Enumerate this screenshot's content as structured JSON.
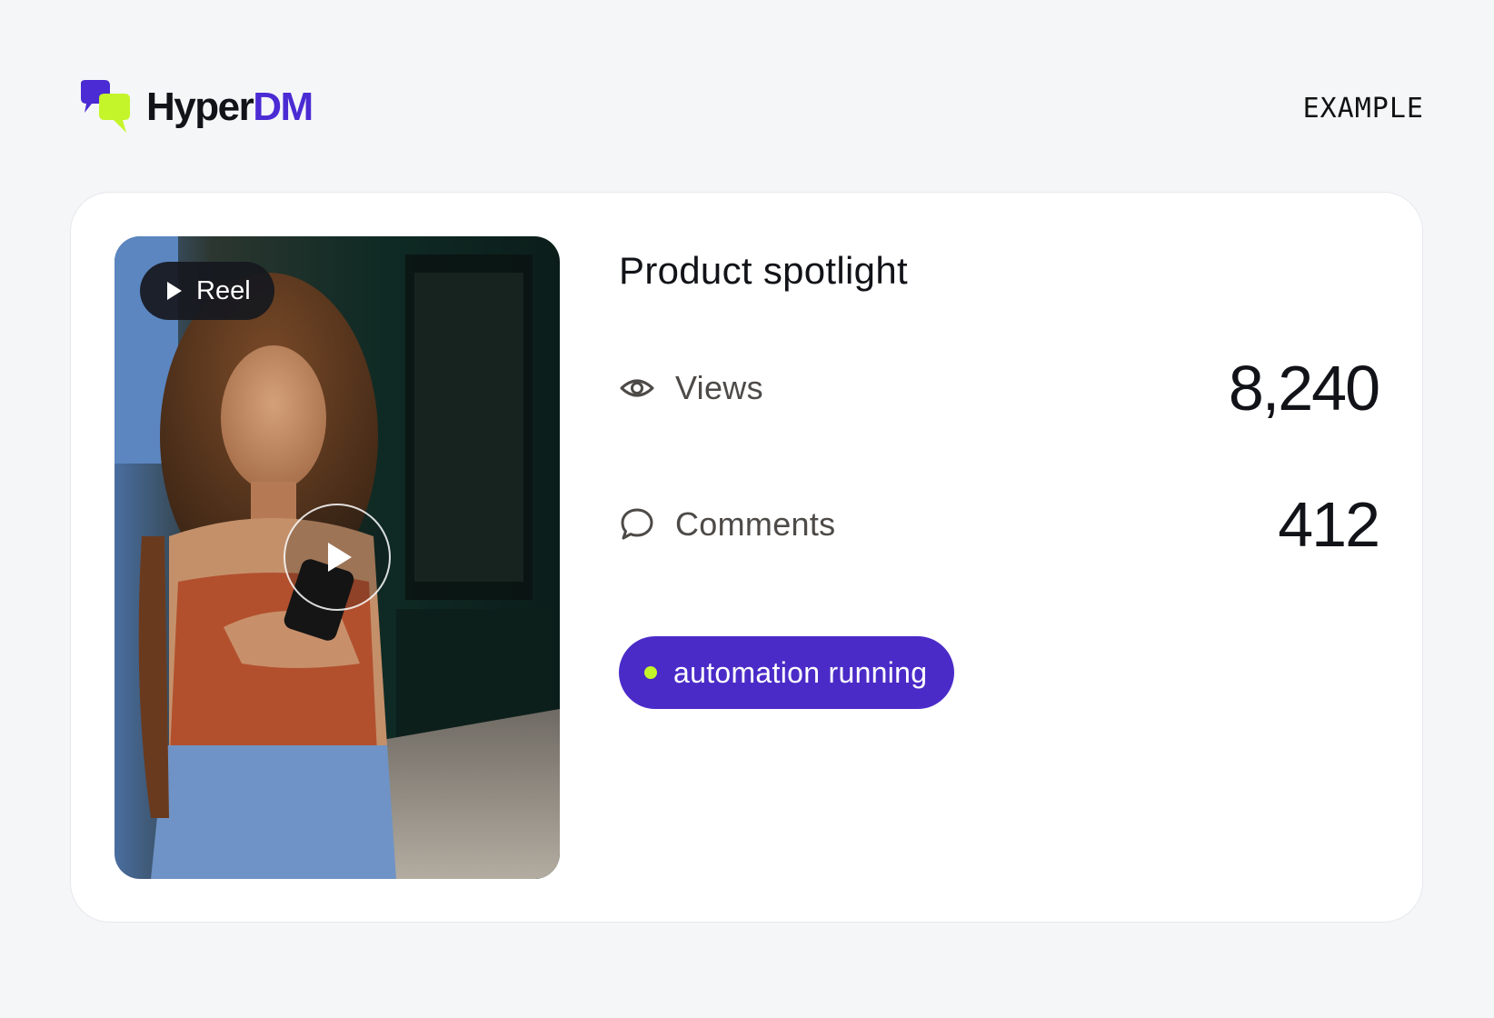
{
  "header": {
    "brand_part1": "Hyper",
    "brand_part2": "DM",
    "tag": "EXAMPLE"
  },
  "card": {
    "media": {
      "badge_label": "Reel",
      "photo_alt": "Woman with curly hair in orange top looking at her phone on a city sidewalk"
    },
    "title": "Product spotlight",
    "stats": [
      {
        "icon": "eye-icon",
        "label": "Views",
        "value": "8,240"
      },
      {
        "icon": "comment-icon",
        "label": "Comments",
        "value": "412"
      }
    ],
    "status": {
      "label": "automation running",
      "dot_color": "#c4f52a"
    }
  },
  "colors": {
    "brand_purple": "#4b2bd3",
    "accent_lime": "#c4f52a",
    "background": "#f5f6f8"
  }
}
